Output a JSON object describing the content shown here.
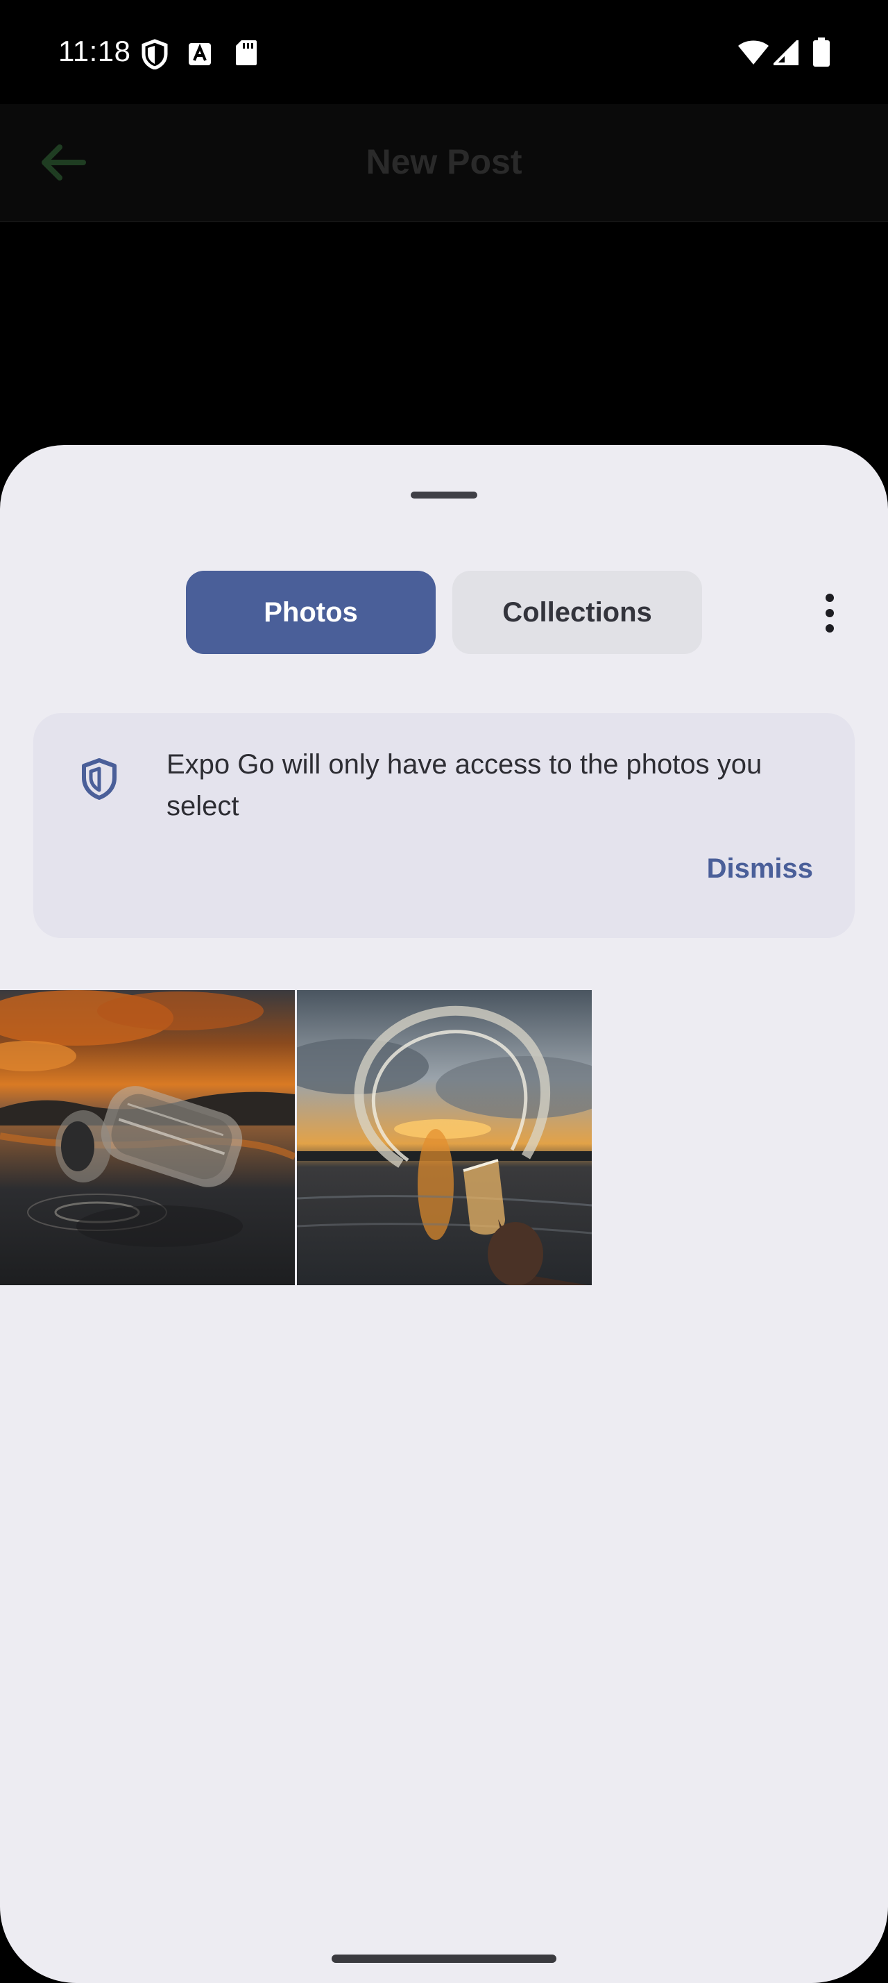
{
  "status_bar": {
    "time": "11:18",
    "icons": [
      "shield-icon",
      "text-a-icon",
      "sd-card-icon",
      "wifi-icon",
      "signal-icon",
      "battery-icon"
    ]
  },
  "app_header": {
    "title": "New Post",
    "back_icon": "arrow-left-icon",
    "accent_color": "#1f3d22"
  },
  "picker": {
    "tabs": [
      {
        "label": "Photos",
        "selected": true
      },
      {
        "label": "Collections",
        "selected": false
      }
    ],
    "more_icon": "more-vertical-icon",
    "notice": {
      "icon": "shield-icon",
      "text": "Expo Go will only have access to the photos you select",
      "action_label": "Dismiss"
    },
    "photos": [
      {
        "name": "bottle-on-water-sunset-photo"
      },
      {
        "name": "water-splash-glass-sunset-photo"
      }
    ]
  },
  "colors": {
    "primary": "#4a5f99",
    "sheet_background": "#edecf2",
    "card_background": "#e4e3ed",
    "text": "#2d2d33"
  }
}
